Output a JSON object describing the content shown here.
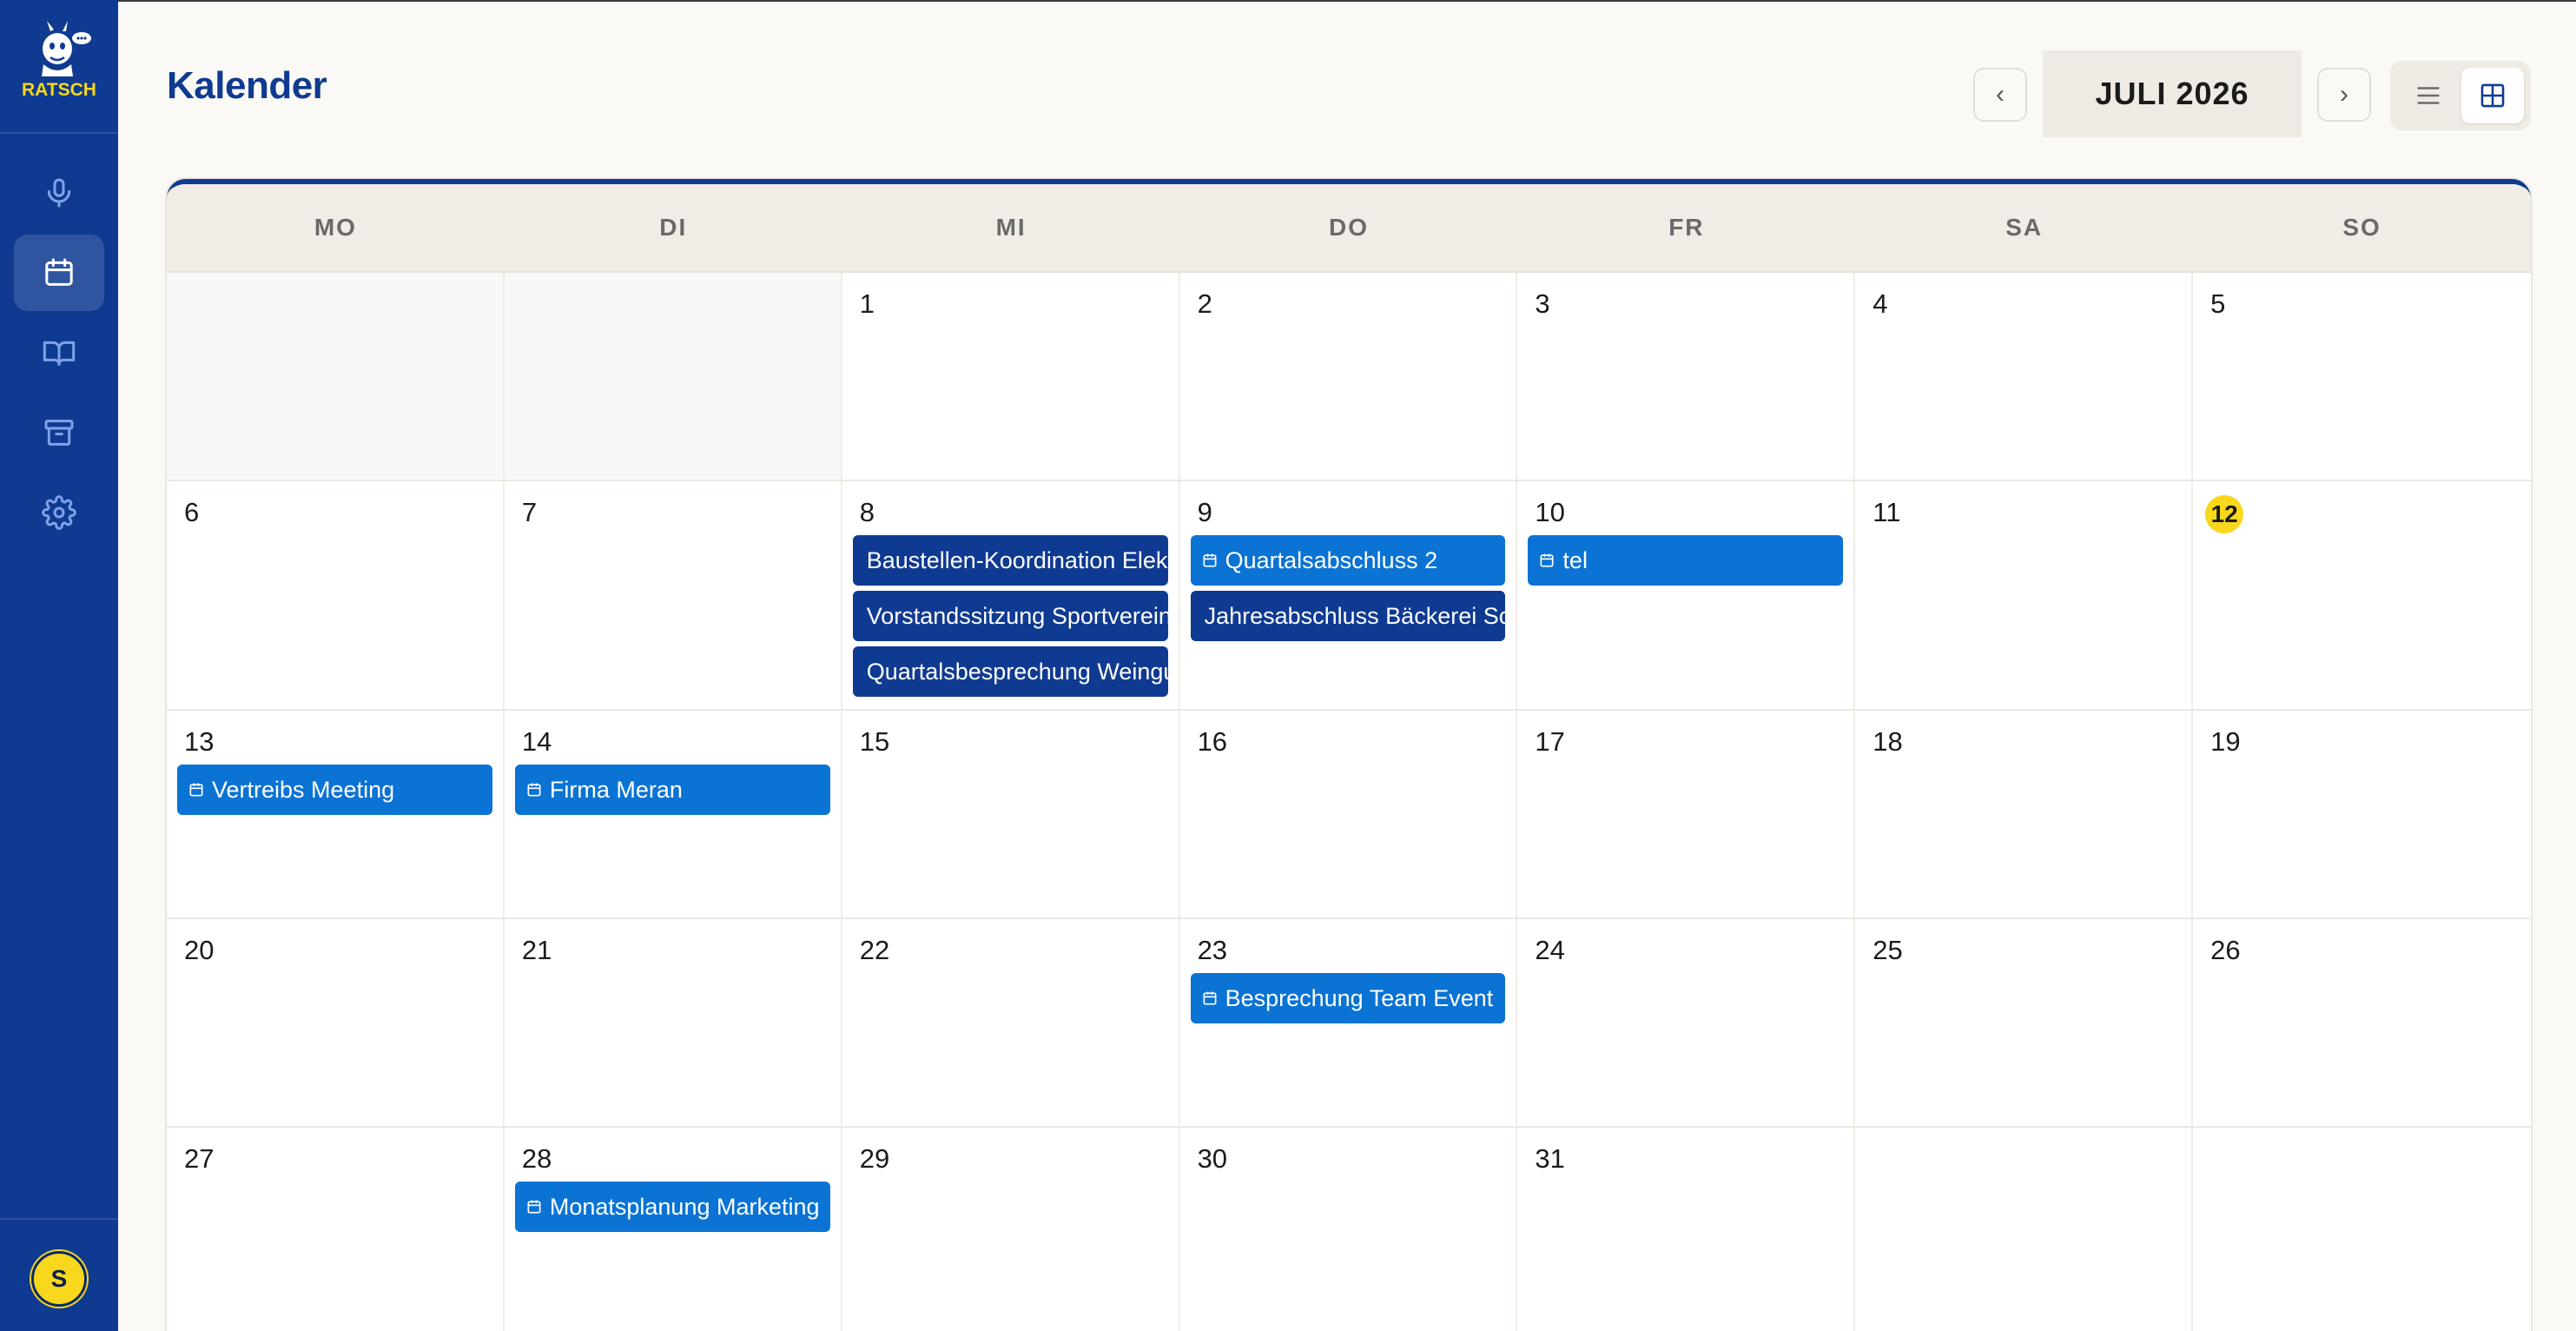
{
  "app": {
    "logo_text": "RATSCH",
    "user_initial": "S"
  },
  "sidebar": {
    "items": [
      {
        "icon": "microphone-icon",
        "active": false
      },
      {
        "icon": "calendar-icon",
        "active": true
      },
      {
        "icon": "book-icon",
        "active": false
      },
      {
        "icon": "archive-icon",
        "active": false
      },
      {
        "icon": "gear-icon",
        "active": false
      }
    ]
  },
  "header": {
    "title": "Kalender",
    "month": "JULI 2026",
    "prev_label": "‹",
    "next_label": "›",
    "view_modes": [
      "list",
      "grid"
    ],
    "active_view": "grid"
  },
  "calendar": {
    "weekdays": [
      "MO",
      "DI",
      "MI",
      "DO",
      "FR",
      "SA",
      "SO"
    ],
    "today": 12,
    "weeks": [
      [
        {
          "day": ""
        },
        {
          "day": ""
        },
        {
          "day": "1"
        },
        {
          "day": "2"
        },
        {
          "day": "3"
        },
        {
          "day": "4"
        },
        {
          "day": "5"
        }
      ],
      [
        {
          "day": "6"
        },
        {
          "day": "7"
        },
        {
          "day": "8",
          "events": [
            {
              "title": "Baustellen-Koordination Elektro",
              "style": "dark"
            },
            {
              "title": "Vorstandssitzung Sportverein",
              "style": "dark"
            },
            {
              "title": "Quartalsbesprechung Weingut",
              "style": "dark"
            }
          ]
        },
        {
          "day": "9",
          "events": [
            {
              "title": "Quartalsabschluss 2",
              "style": "light"
            },
            {
              "title": "Jahresabschluss Bäckerei Sch",
              "style": "dark"
            }
          ]
        },
        {
          "day": "10",
          "events": [
            {
              "title": "tel",
              "style": "light"
            }
          ]
        },
        {
          "day": "11"
        },
        {
          "day": "12",
          "today": true
        }
      ],
      [
        {
          "day": "13",
          "events": [
            {
              "title": "Vertreibs Meeting",
              "style": "light"
            }
          ]
        },
        {
          "day": "14",
          "events": [
            {
              "title": "Firma Meran",
              "style": "light"
            }
          ]
        },
        {
          "day": "15"
        },
        {
          "day": "16"
        },
        {
          "day": "17"
        },
        {
          "day": "18"
        },
        {
          "day": "19"
        }
      ],
      [
        {
          "day": "20"
        },
        {
          "day": "21"
        },
        {
          "day": "22"
        },
        {
          "day": "23",
          "events": [
            {
              "title": "Besprechung Team Event",
              "style": "light"
            }
          ]
        },
        {
          "day": "24"
        },
        {
          "day": "25"
        },
        {
          "day": "26"
        }
      ],
      [
        {
          "day": "27"
        },
        {
          "day": "28",
          "events": [
            {
              "title": "Monatsplanung Marketing",
              "style": "light"
            }
          ]
        },
        {
          "day": "29"
        },
        {
          "day": "30"
        },
        {
          "day": "31"
        },
        {
          "day": "",
          "blank": true
        },
        {
          "day": "",
          "blank": true
        }
      ]
    ]
  }
}
